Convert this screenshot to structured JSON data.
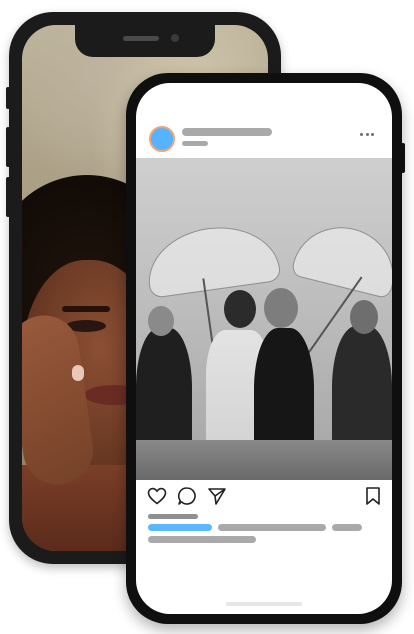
{
  "scene": {
    "description_label": ""
  },
  "back_phone": {
    "icon": "portrait-photo",
    "colors": {
      "frame": "#1b1b1b",
      "skin": "#7a4430",
      "hair": "#140c07",
      "background": "#b3a88e"
    }
  },
  "front_phone": {
    "post": {
      "avatar_color": "#55b3ff",
      "avatar_ring_color": "#f3a27a",
      "more_icon": "more-horizontal-icon",
      "photo_icon": "wedding-photo",
      "actions": [
        {
          "name": "like",
          "icon": "heart-icon"
        },
        {
          "name": "comment",
          "icon": "comment-icon"
        },
        {
          "name": "share",
          "icon": "send-icon"
        },
        {
          "name": "save",
          "icon": "bookmark-icon"
        }
      ],
      "placeholder_color": "#a9a9a9",
      "highlight_color": "#5ab8ff"
    }
  }
}
